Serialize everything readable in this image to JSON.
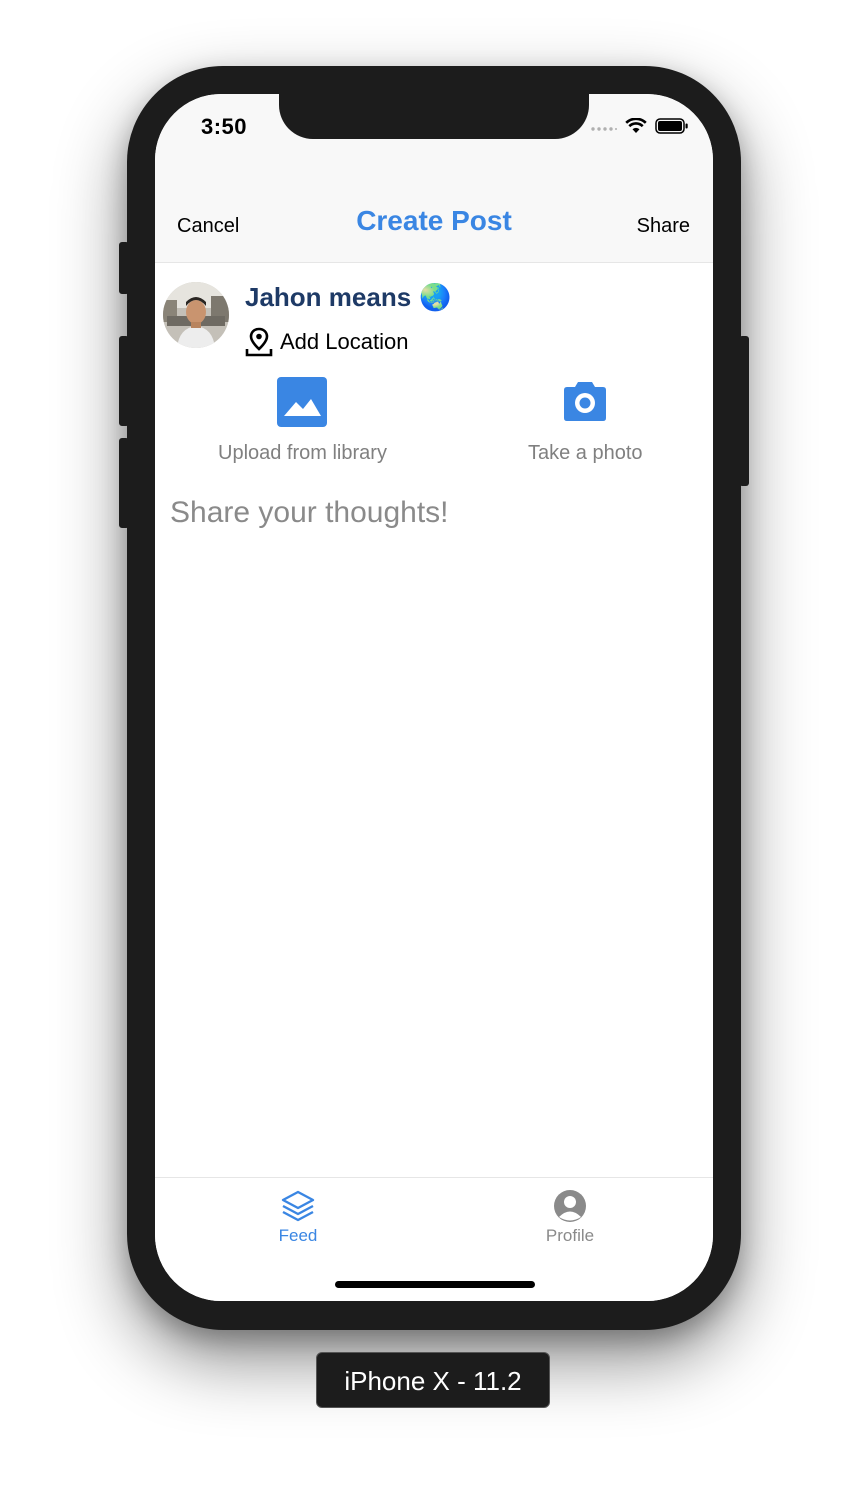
{
  "status_bar": {
    "time": "3:50"
  },
  "nav": {
    "cancel_label": "Cancel",
    "title": "Create Post",
    "share_label": "Share"
  },
  "user": {
    "name": "Jahon means",
    "emoji": "🌏",
    "add_location_label": "Add Location"
  },
  "media": {
    "upload_label": "Upload from library",
    "photo_label": "Take a photo"
  },
  "composer": {
    "placeholder": "Share your thoughts!"
  },
  "tabs": [
    {
      "label": "Feed",
      "icon": "layers-icon",
      "active": true
    },
    {
      "label": "Profile",
      "icon": "user-circle-icon",
      "active": false
    }
  ],
  "device_label": "iPhone X - 11.2",
  "colors": {
    "accent": "#3a86e3",
    "username": "#1e3a66",
    "muted": "#808080",
    "tab_inactive": "#8a8a8a"
  }
}
